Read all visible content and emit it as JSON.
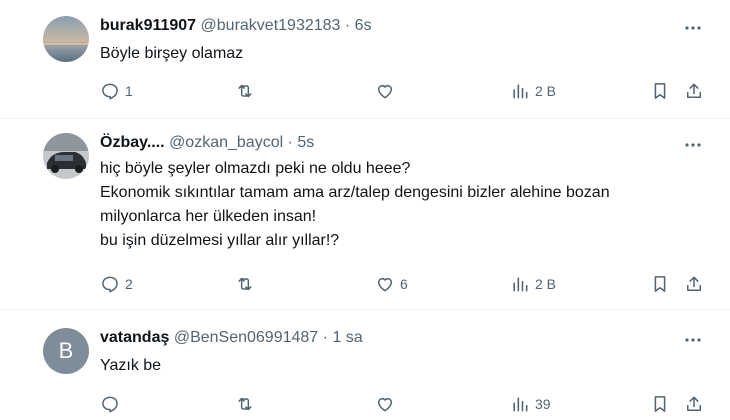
{
  "colors": {
    "text": "#0f1419",
    "muted": "#536471",
    "divider": "#eff3f4",
    "avatar_letter_bg": "#7f8c99"
  },
  "tweets": [
    {
      "name": "burak911907",
      "handle": "@burakvet1932183",
      "separator": "·",
      "time": "6s",
      "text_lines": [
        "Böyle birşey olamaz"
      ],
      "avatar": "sunset-photo",
      "actions": {
        "replies": "1",
        "retweets": "",
        "likes": "",
        "views": "2 B"
      }
    },
    {
      "name": "Özbay....",
      "handle": "@ozkan_baycol",
      "separator": "·",
      "time": "5s",
      "text_lines": [
        "hiç böyle şeyler olmazdı peki ne oldu heee?",
        "Ekonomik sıkıntılar tamam ama arz/talep dengesini bizler alehine bozan",
        "milyonlarca her ülkeden insan!",
        "bu işin düzelmesi yıllar alır yıllar!?"
      ],
      "avatar": "car-photo",
      "actions": {
        "replies": "2",
        "retweets": "",
        "likes": "6",
        "views": "2 B"
      }
    },
    {
      "name": "vatandaş",
      "handle": "@BenSen06991487",
      "separator": "·",
      "time": "1 sa",
      "text_lines": [
        "Yazık be"
      ],
      "avatar": "letter-avatar",
      "avatar_letter": "B",
      "actions": {
        "replies": "",
        "retweets": "",
        "likes": "",
        "views": "39"
      }
    }
  ]
}
